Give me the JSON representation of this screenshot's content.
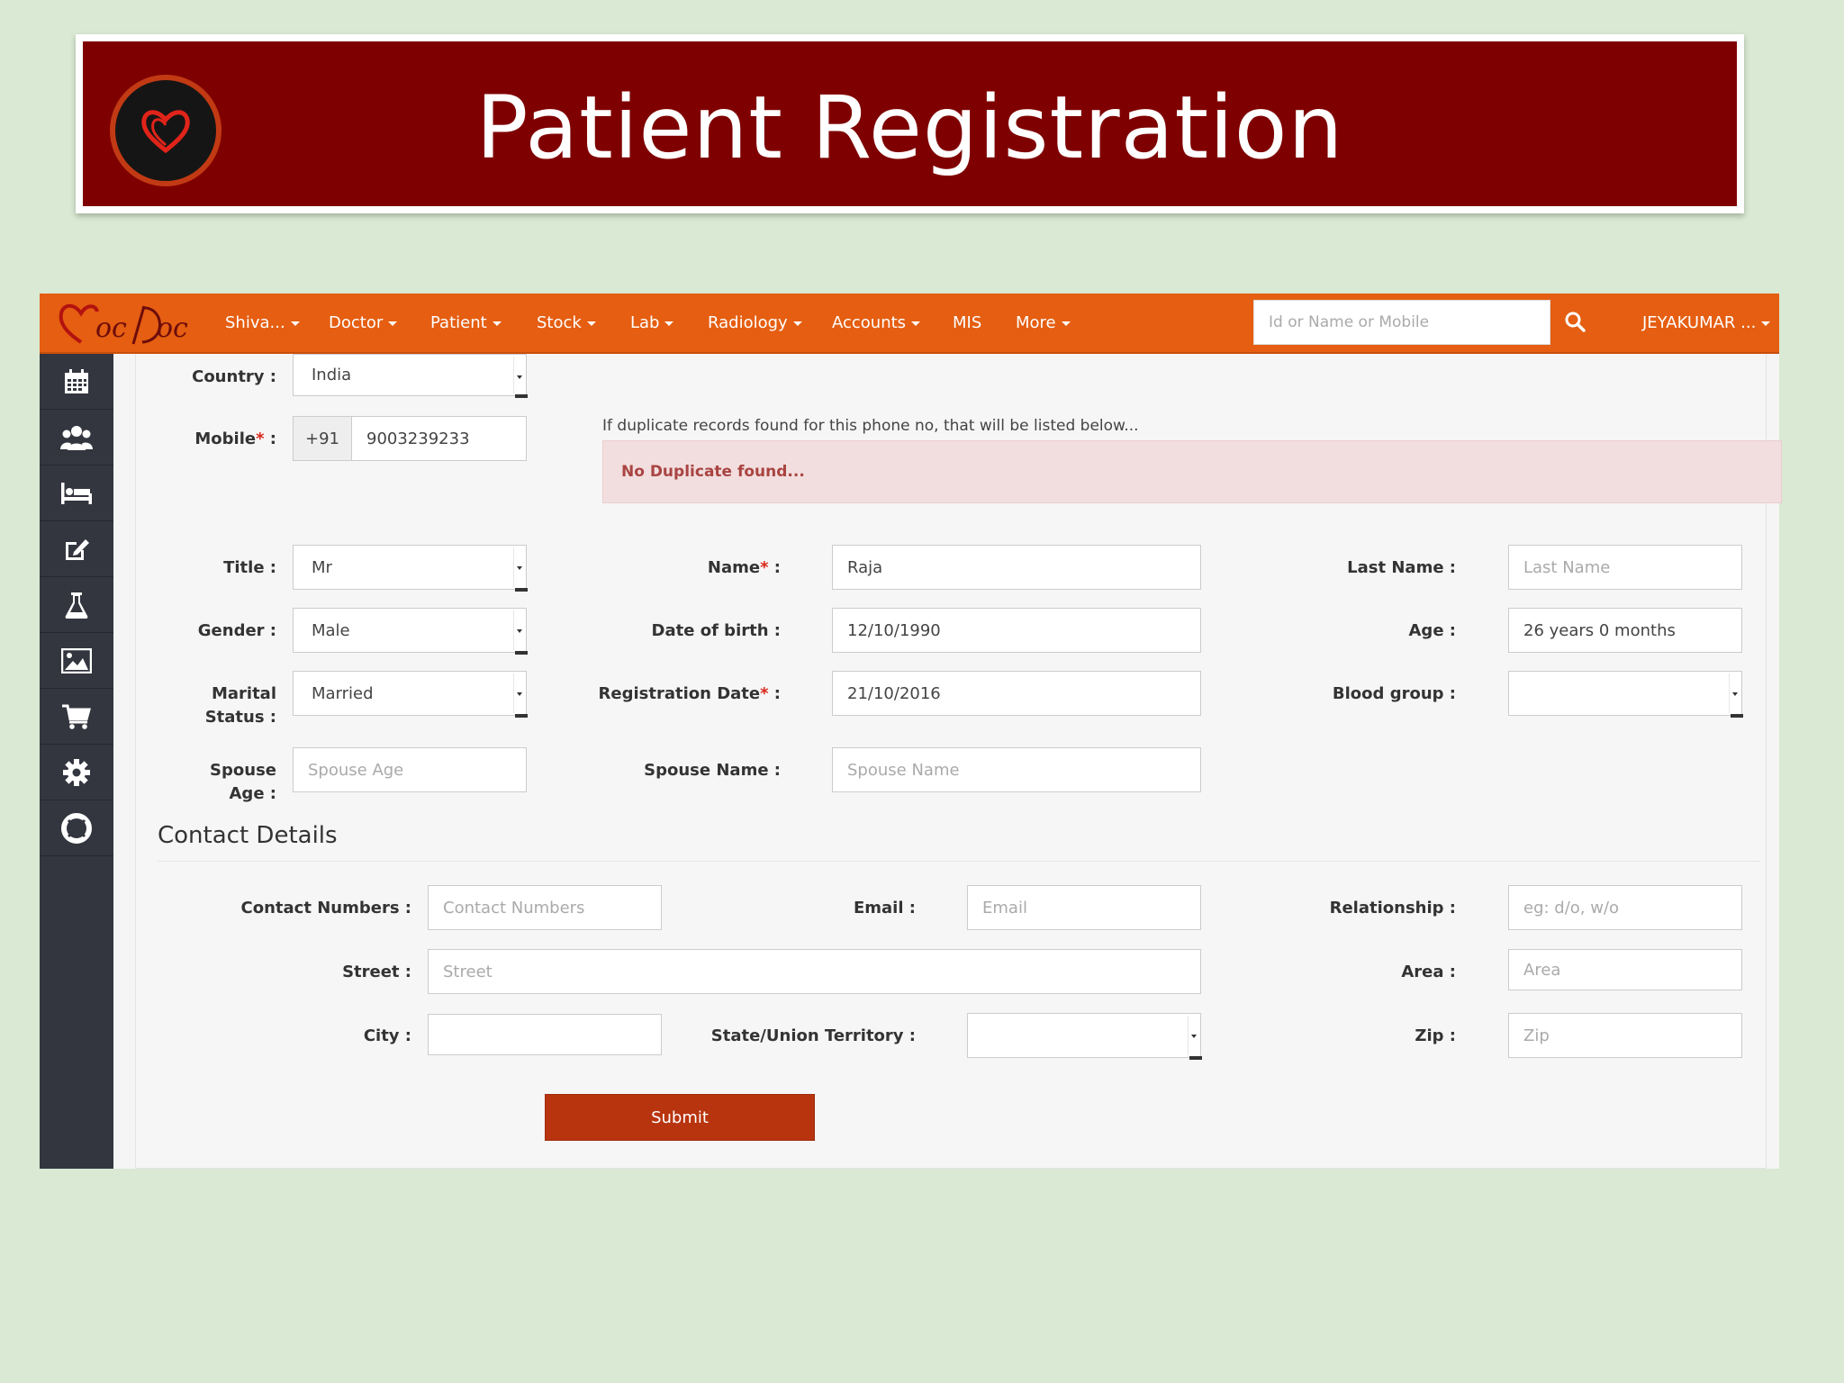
{
  "slide": {
    "title": "Patient Registration"
  },
  "navbar": {
    "items": [
      {
        "label": "Shiva...",
        "dropdown": true
      },
      {
        "label": "Doctor",
        "dropdown": true
      },
      {
        "label": "Patient",
        "dropdown": true
      },
      {
        "label": "Stock",
        "dropdown": true
      },
      {
        "label": "Lab",
        "dropdown": true
      },
      {
        "label": "Radiology",
        "dropdown": true
      },
      {
        "label": "Accounts",
        "dropdown": true
      },
      {
        "label": "MIS",
        "dropdown": false
      },
      {
        "label": "More",
        "dropdown": true
      }
    ],
    "search_placeholder": "Id or Name or Mobile",
    "user": "JEYAKUMAR ..."
  },
  "sidebar": {
    "icons": [
      "calendar-icon",
      "users-icon",
      "bed-icon",
      "edit-icon",
      "flask-icon",
      "image-icon",
      "cart-icon",
      "gear-icon",
      "lifebuoy-icon"
    ]
  },
  "form": {
    "country": {
      "label": "Country :",
      "value": "India"
    },
    "mobile": {
      "label": "Mobile",
      "req": "*",
      "suffix": " :",
      "prefix": "+91",
      "value": "9003239233"
    },
    "duplicate_note": "If duplicate records found for this phone no, that will be listed below...",
    "duplicate_alert": "No Duplicate found...",
    "title": {
      "label": "Title :",
      "value": "Mr"
    },
    "name": {
      "label": "Name",
      "req": "*",
      "suffix": " :",
      "value": "Raja"
    },
    "last_name": {
      "label": "Last Name :",
      "placeholder": "Last Name"
    },
    "gender": {
      "label": "Gender :",
      "value": "Male"
    },
    "dob": {
      "label": "Date of birth :",
      "value": "12/10/1990"
    },
    "age": {
      "label": "Age :",
      "value": "26 years 0 months"
    },
    "marital_status": {
      "label_line1": "Marital",
      "label_line2": "Status :",
      "value": "Married"
    },
    "registration_date": {
      "label": "Registration Date",
      "req": "*",
      "suffix": " :",
      "value": "21/10/2016"
    },
    "blood_group": {
      "label": "Blood group :",
      "value": ""
    },
    "spouse_age": {
      "label_line1": "Spouse",
      "label_line2": "Age :",
      "placeholder": "Spouse Age"
    },
    "spouse_name": {
      "label": "Spouse Name :",
      "placeholder": "Spouse Name"
    }
  },
  "contact": {
    "section_title": "Contact Details",
    "contact_numbers": {
      "label": "Contact Numbers :",
      "placeholder": "Contact Numbers"
    },
    "email": {
      "label": "Email :",
      "placeholder": "Email"
    },
    "relationship": {
      "label": "Relationship :",
      "placeholder": "eg: d/o, w/o"
    },
    "street": {
      "label": "Street :",
      "placeholder": "Street"
    },
    "area": {
      "label": "Area :",
      "placeholder": "Area"
    },
    "city": {
      "label": "City :",
      "placeholder": ""
    },
    "state": {
      "label": "State/Union Territory :",
      "value": ""
    },
    "zip": {
      "label": "Zip :",
      "placeholder": "Zip"
    },
    "submit_label": "Submit"
  },
  "colors": {
    "banner": "#7f0000",
    "navbar": "#e55e11",
    "sidebar": "#33363f",
    "submit": "#b8340e",
    "alert_bg": "#f2dede",
    "alert_text": "#a94442"
  }
}
